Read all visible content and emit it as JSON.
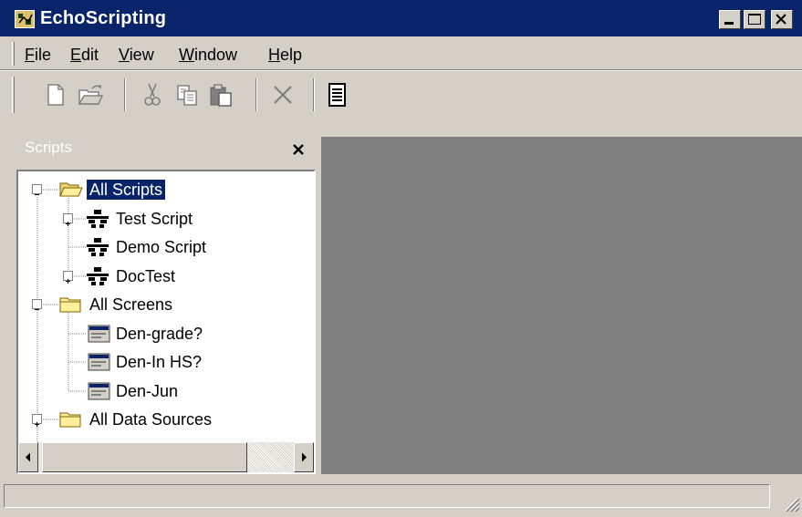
{
  "window": {
    "title": "EchoScripting"
  },
  "menu": [
    {
      "label": "File"
    },
    {
      "label": "Edit"
    },
    {
      "label": "View"
    },
    {
      "label": "Window"
    },
    {
      "label": "Help"
    }
  ],
  "toolbar": {
    "icons": [
      "new-document-icon",
      "open-folder-icon",
      "cut-icon",
      "copy-icon",
      "paste-icon",
      "delete-icon",
      "properties-icon"
    ]
  },
  "scripts_pane": {
    "title": "Scripts",
    "tree": [
      {
        "label": "All Scripts",
        "icon": "folder-open-icon",
        "expanded": true,
        "selected": true
      },
      {
        "label": "Test Script",
        "icon": "script-icon",
        "has_children": true
      },
      {
        "label": "Demo Script",
        "icon": "script-icon"
      },
      {
        "label": "DocTest",
        "icon": "script-icon",
        "has_children": true
      },
      {
        "label": "All Screens",
        "icon": "folder-icon",
        "expanded": true
      },
      {
        "label": "Den-grade?",
        "icon": "screen-icon"
      },
      {
        "label": "Den-In HS?",
        "icon": "screen-icon"
      },
      {
        "label": "Den-Jun",
        "icon": "screen-icon"
      },
      {
        "label": "All Data Sources",
        "icon": "folder-icon",
        "has_children": true
      }
    ]
  },
  "status_bar": {
    "text": ""
  },
  "colors": {
    "title_bar": "#0a246a",
    "face": "#d4d0c8",
    "mdi_background": "#808080",
    "selection": "#0a246a"
  }
}
